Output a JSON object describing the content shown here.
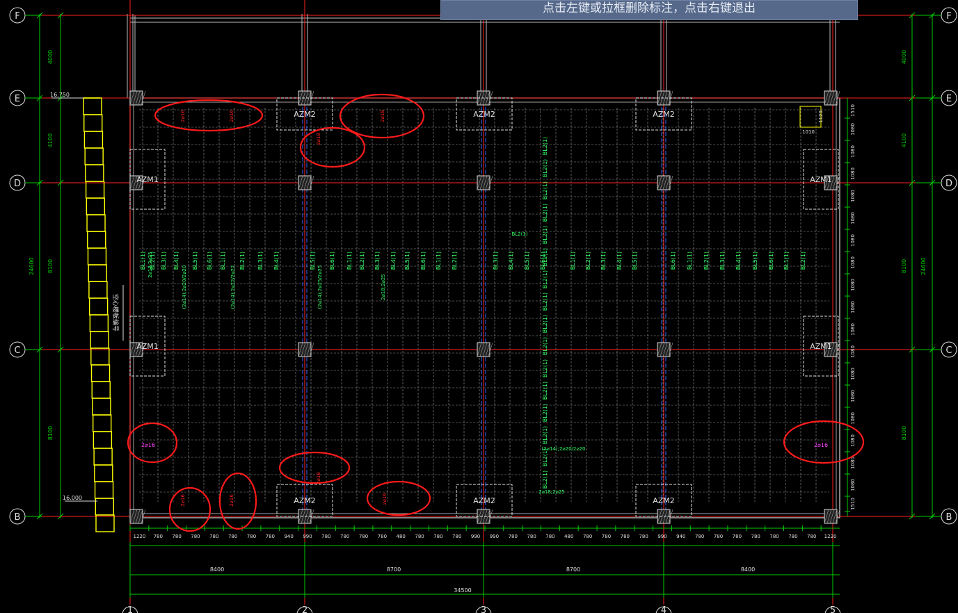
{
  "prompt": {
    "text": "点击左键或拉框删除标注，点击右键退出"
  },
  "axes": {
    "rows": [
      "F",
      "E",
      "D",
      "C",
      "B"
    ],
    "cols": [
      "1",
      "2",
      "3",
      "4",
      "5"
    ]
  },
  "elevations": [
    "16.750",
    "16.000"
  ],
  "left_dims": [
    "4000",
    "4100",
    "8100",
    "8100",
    "24600"
  ],
  "right_dims": [
    "4000",
    "4100",
    "8100",
    "8100",
    "24600"
  ],
  "bottom_spacing": [
    "1220",
    "780",
    "780",
    "780",
    "780",
    "780",
    "780",
    "780",
    "940",
    "990",
    "780",
    "780",
    "780",
    "780",
    "480",
    "780",
    "780",
    "780",
    "990",
    "990",
    "780",
    "780",
    "780",
    "480",
    "780",
    "780",
    "780",
    "780",
    "990",
    "940",
    "780",
    "780",
    "780",
    "780",
    "780",
    "780",
    "780",
    "1220"
  ],
  "bottom_spans": [
    "8400",
    "8700",
    "8700",
    "8400"
  ],
  "bottom_total": "34500",
  "right_spacing": [
    "1510",
    "1080",
    "1080",
    "1080",
    "1080",
    "1080",
    "1080",
    "1080",
    "1080",
    "1080",
    "1080",
    "1080",
    "1080",
    "1080",
    "1080",
    "1080",
    "1080",
    "1080",
    "1510"
  ],
  "wall_labels": {
    "azm1": "AZM1",
    "azm2": "AZM2"
  },
  "beam_labels": [
    "BL1(1)",
    "BL2(1)",
    "BL3(1)",
    "BL4(1)",
    "BL5(1)",
    "BL6(1)"
  ],
  "rebar_labels": [
    "2⌀18;2⌀25",
    "(2⌀14);2⌀20/2⌀20",
    "(2⌀14);2⌀22/2⌀22",
    "(2⌀14);2⌀25/2⌀25",
    "2⌀18;2⌀25",
    "BL2(1)"
  ],
  "marked_annotations": [
    "2⌀16",
    "2⌀16",
    "2⌀18",
    "2⌀18",
    "2⌀16",
    "2⌀16",
    "2⌀18",
    "2⌀16",
    "2⌀16",
    "2⌀18"
  ],
  "magenta_labels": [
    "2⌀16",
    "2⌀16"
  ],
  "side_note": "空心楼板编号",
  "corner_dims": [
    "1120",
    "1010"
  ],
  "colors": {
    "grid": "#00cc00",
    "axis": "#ff2020",
    "yellow": "#ffff00",
    "cyan": "#00ffff",
    "mark": "#ff2020",
    "magenta": "#ff40ff"
  }
}
